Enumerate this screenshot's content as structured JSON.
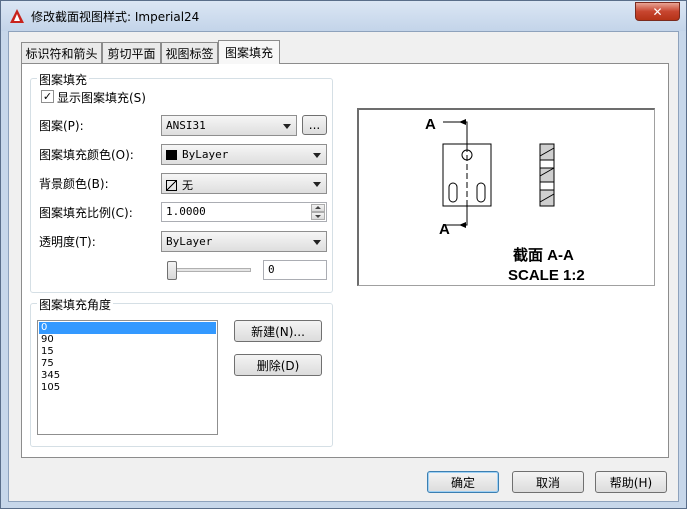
{
  "window": {
    "title": "修改截面视图样式: Imperial24",
    "close_label": "✕"
  },
  "tabs": [
    {
      "label": "标识符和箭头",
      "active": false
    },
    {
      "label": "剪切平面",
      "active": false
    },
    {
      "label": "视图标签",
      "active": false
    },
    {
      "label": "图案填充",
      "active": true
    }
  ],
  "hatch_group": {
    "title": "图案填充",
    "show_hatch": {
      "label": "显示图案填充(S)",
      "checked": true
    },
    "pattern": {
      "label": "图案(P):",
      "value": "ANSI31",
      "browse_label": "..."
    },
    "hatch_color": {
      "label": "图案填充颜色(O):",
      "value": "ByLayer",
      "swatch": "#000000"
    },
    "background_color": {
      "label": "背景颜色(B):",
      "value": "无"
    },
    "hatch_scale": {
      "label": "图案填充比例(C):",
      "value": "1.0000"
    },
    "transparency": {
      "label": "透明度(T):",
      "value": "ByLayer",
      "slider_value": "0",
      "slider_fraction": 0
    }
  },
  "angle_group": {
    "title": "图案填充角度",
    "angles": [
      "0",
      "90",
      "15",
      "75",
      "345",
      "105"
    ],
    "selected_index": 0,
    "new_label": "新建(N)...",
    "delete_label": "删除(D)"
  },
  "preview": {
    "marker_top": "A",
    "marker_bottom": "A",
    "caption_line1": "截面 A-A",
    "caption_line2": "SCALE 1:2"
  },
  "footer": {
    "ok_label": "确定",
    "cancel_label": "取消",
    "help_label": "帮助(H)"
  },
  "colors": {
    "title_bar": "#c7d7ea",
    "close_button": "#c7452f",
    "selection": "#3399ff",
    "app_icon": "#c8231c"
  }
}
